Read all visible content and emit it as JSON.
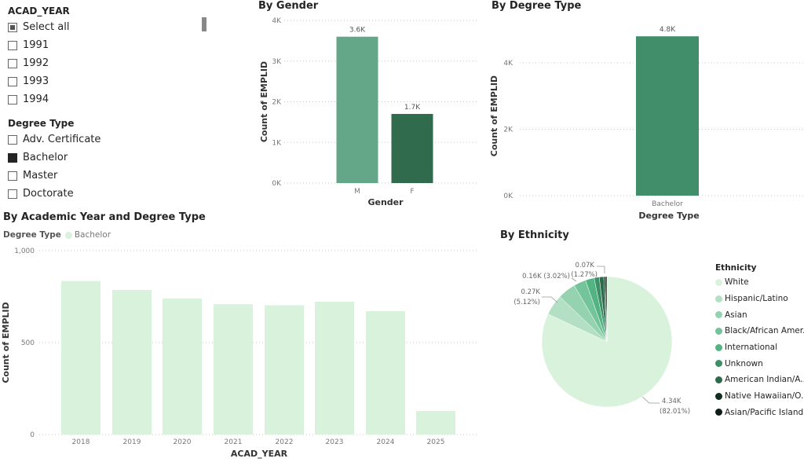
{
  "slicers": {
    "acad_year": {
      "title": "ACAD_YEAR",
      "items": [
        {
          "label": "Select all",
          "state": "partial"
        },
        {
          "label": "1991",
          "state": "unchecked"
        },
        {
          "label": "1992",
          "state": "unchecked"
        },
        {
          "label": "1993",
          "state": "unchecked"
        },
        {
          "label": "1994",
          "state": "unchecked"
        }
      ]
    },
    "degree_type": {
      "title": "Degree Type",
      "items": [
        {
          "label": "Adv. Certificate",
          "state": "unchecked"
        },
        {
          "label": "Bachelor",
          "state": "checked"
        },
        {
          "label": "Master",
          "state": "unchecked"
        },
        {
          "label": "Doctorate",
          "state": "unchecked"
        }
      ]
    }
  },
  "chart_data": [
    {
      "id": "gender",
      "type": "bar",
      "title": "By Gender",
      "xlabel": "Gender",
      "ylabel": "Count of EMPLID",
      "categories": [
        "M",
        "F"
      ],
      "values": [
        3600,
        1700
      ],
      "data_labels": [
        "3.6K",
        "1.7K"
      ],
      "colors": [
        "#64a788",
        "#306b4e"
      ],
      "ylim": [
        0,
        4000
      ],
      "yticks": [
        0,
        1000,
        2000,
        3000,
        4000
      ],
      "ytick_labels": [
        "0K",
        "1K",
        "2K",
        "3K",
        "4K"
      ],
      "grid": true
    },
    {
      "id": "degree",
      "type": "bar",
      "title": "By Degree Type",
      "xlabel": "Degree Type",
      "ylabel": "Count of EMPLID",
      "categories": [
        "Bachelor"
      ],
      "values": [
        4800
      ],
      "data_labels": [
        "4.8K"
      ],
      "colors": [
        "#418f6a"
      ],
      "ylim": [
        0,
        4800
      ],
      "yticks": [
        0,
        2000,
        4000
      ],
      "ytick_labels": [
        "0K",
        "2K",
        "4K"
      ],
      "grid": true
    },
    {
      "id": "year",
      "type": "bar",
      "title": "By Academic Year and Degree Type",
      "legend_title": "Degree Type",
      "legend": [
        {
          "name": "Bachelor",
          "color": "#d8f2dc"
        }
      ],
      "xlabel": "ACAD_YEAR",
      "ylabel": "Count of EMPLID",
      "categories": [
        "2018",
        "2019",
        "2020",
        "2021",
        "2022",
        "2023",
        "2024",
        "2025"
      ],
      "series": [
        {
          "name": "Bachelor",
          "values": [
            835,
            786,
            739,
            709,
            703,
            722,
            671,
            128
          ]
        }
      ],
      "ylim": [
        0,
        1000
      ],
      "yticks": [
        0,
        500,
        1000
      ],
      "ytick_labels": [
        "0",
        "500",
        "1,000"
      ],
      "grid": true
    },
    {
      "id": "ethnicity",
      "type": "pie",
      "title": "By Ethnicity",
      "legend_title": "Ethnicity",
      "legend_position": "right",
      "slices": [
        {
          "label": "White",
          "percent": 82.01,
          "color": "#d8f2dc",
          "data_label": "4.34K (82.01%)"
        },
        {
          "label": "Hispanic/Latino",
          "percent": 5.12,
          "color": "#b3e0c4",
          "data_label": "0.27K (5.12%)"
        },
        {
          "label": "Asian",
          "percent": 4.5,
          "color": "#94d2b0",
          "data_label": ""
        },
        {
          "label": "Black/African Amer...",
          "percent": 3.02,
          "color": "#74c49b",
          "data_label": "0.16K (3.02%)"
        },
        {
          "label": "International",
          "percent": 2.2,
          "color": "#52b483",
          "data_label": ""
        },
        {
          "label": "Unknown",
          "percent": 1.27,
          "color": "#3c8f66",
          "data_label": "0.07K (1.27%)"
        },
        {
          "label": "American Indian/A...",
          "percent": 1.1,
          "color": "#2b6a4a",
          "data_label": ""
        },
        {
          "label": "Native Hawaiian/O...",
          "percent": 0.4,
          "color": "#132d20",
          "data_label": ""
        },
        {
          "label": "Asian/Pacific Island...",
          "percent": 0.38,
          "color": "#0d1f16",
          "data_label": ""
        }
      ]
    }
  ]
}
